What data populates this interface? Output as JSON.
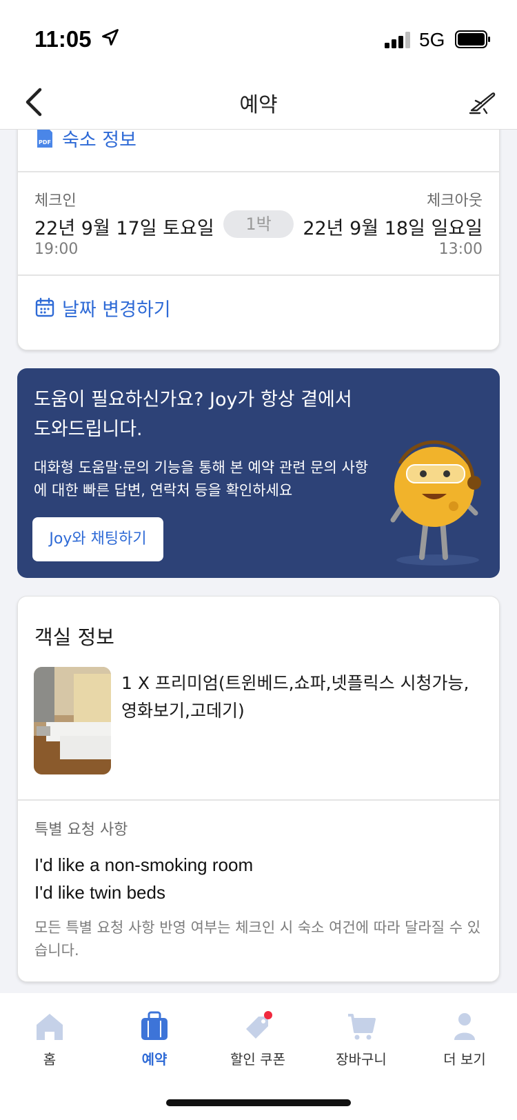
{
  "status_bar": {
    "time": "11:05",
    "network": "5G"
  },
  "header": {
    "title": "예약"
  },
  "stay": {
    "pdf_label": "숙소 정보",
    "checkin_label": "체크인",
    "checkout_label": "체크아웃",
    "checkin_date": "22년 9월 17일 토요일",
    "checkout_date": "22년 9월 18일 일요일",
    "nights": "1박",
    "checkin_time": "19:00",
    "checkout_time": "13:00",
    "change_date_label": "날짜 변경하기"
  },
  "joy_banner": {
    "title": "도움이 필요하신가요? Joy가 항상 곁에서 도와드립니다.",
    "description": "대화형 도움말·문의 기능을 통해 본 예약 관련 문의 사항에 대한 빠른 답변, 연락처 등을 확인하세요",
    "button_label": "Joy와 채팅하기"
  },
  "room": {
    "heading": "객실 정보",
    "name": "1 X 프리미엄(트윈베드,쇼파,넷플릭스 시청가능,영화보기,고데기)",
    "special_requests_label": "특별 요청 사항",
    "requests": [
      "I'd like a non-smoking room",
      "I'd like twin beds"
    ],
    "note": "모든 특별 요청 사항 반영 여부는 체크인 시 숙소 여건에 따라 달라질 수 있습니다."
  },
  "tabs": [
    {
      "label": "홈",
      "icon": "home-icon",
      "active": false
    },
    {
      "label": "예약",
      "icon": "suitcase-icon",
      "active": true
    },
    {
      "label": "할인 쿠폰",
      "icon": "tag-icon",
      "active": false
    },
    {
      "label": "장바구니",
      "icon": "cart-icon",
      "active": false
    },
    {
      "label": "더 보기",
      "icon": "person-icon",
      "active": false
    }
  ],
  "colors": {
    "accent": "#2e6ad6",
    "banner": "#2d4277",
    "notification": "#f0293e"
  }
}
